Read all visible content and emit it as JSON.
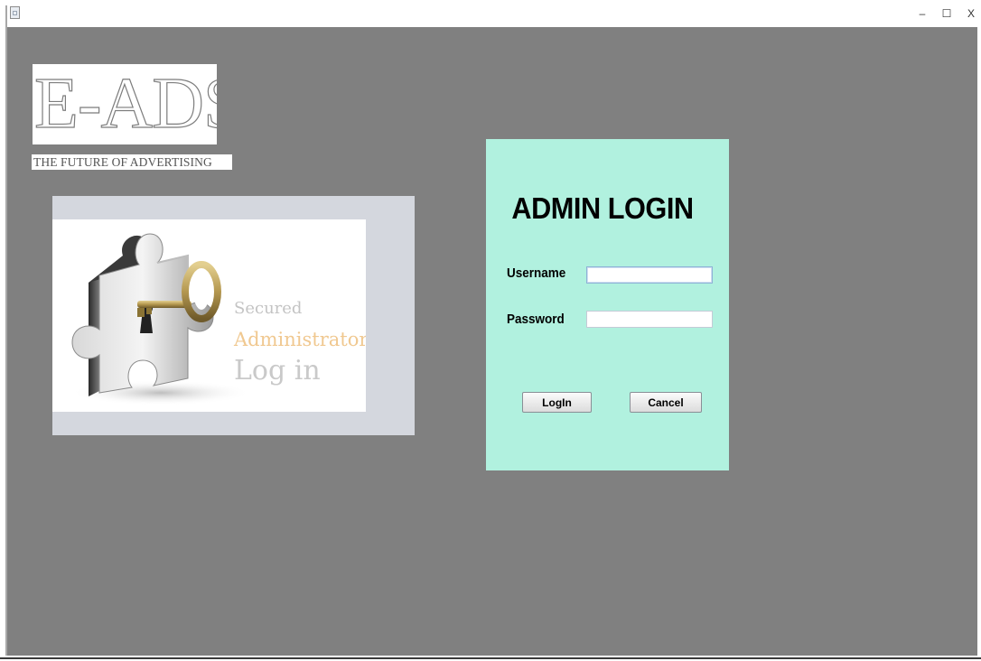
{
  "window": {
    "title": "",
    "controls": {
      "minimize": "–",
      "maximize": "☐",
      "close": "X"
    }
  },
  "logo": {
    "text": "E-ADS",
    "tagline": "THE FUTURE OF ADVERTISING"
  },
  "illustration": {
    "lines": [
      "Secured",
      "Administrator",
      "Log in"
    ],
    "icons": [
      "puzzle-piece-icon",
      "key-icon"
    ]
  },
  "login": {
    "title": "ADMIN LOGIN",
    "username_label": "Username",
    "username_value": "",
    "password_label": "Password",
    "password_value": "",
    "login_button": "LogIn",
    "cancel_button": "Cancel"
  },
  "colors": {
    "background": "#808080",
    "login_card": "#b1f1df",
    "illustration_panel": "#d4d7de",
    "accent_text": "#f0c890"
  }
}
